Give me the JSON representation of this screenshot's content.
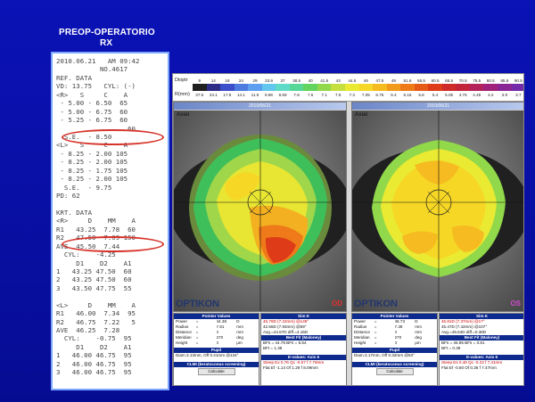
{
  "slide": {
    "title_line1": "PREOP-OPERATORIO",
    "title_line2": "RX"
  },
  "receipt": {
    "lines": [
      "2010.06.21   AM 09:42",
      "           NO.4617",
      "REF. DATA",
      "VD: 13.75   CYL: (-)",
      "<R>   S     C    A",
      " - 5.00 - 6.50  65",
      " - 5.00 - 6.75  60",
      " - 5.25 - 6.75  60",
      "                  60",
      "  S.E.  - 8.50",
      "<L>   S     C    A",
      " - 8.25 - 2.00 105",
      " - 8.25 - 2.00 105",
      " - 8.25 - 1.75 105",
      " - 8.25 - 2.00 105",
      "  S.E.  - 9.75",
      "PD: 62",
      "",
      "KRT. DATA",
      "<R>     D    MM    A",
      "R1   43.25  7.78  60",
      "R2   47.50  7.09 150",
      "AVE  45.50  7.44",
      "  CYL:    -4.25",
      "     D1    D2    A1",
      "1   43.25 47.50  60",
      "2   43.25 47.50  60",
      "3   43.50 47.75  55",
      "",
      "<L>     D    MM    A",
      "R1   46.00  7.34  95",
      "R2   46.75  7.22   5",
      "AVE  46.25  7.28",
      "  CYL:    -0.75  95",
      "     D1    D2    A1",
      "1   46.00 46.75  95",
      "2   46.00 46.75  95",
      "3   46.00 46.75  95"
    ]
  },
  "topo": {
    "scale": {
      "dioptr_label": "Dioptr",
      "r_label": "R(mm)",
      "dioptr": [
        "9",
        "14",
        "19",
        "24",
        "29",
        "33.9",
        "37",
        "38.5",
        "40",
        "41.5",
        "43",
        "44.5",
        "46",
        "47.5",
        "49",
        "51.6",
        "55.5",
        "60.5",
        "65.5",
        "70.5",
        "75.5",
        "80.5",
        "85.5",
        "90.5"
      ],
      "rmm": [
        "37.5",
        "24.1",
        "17.8",
        "14.1",
        "11.6",
        "9.96",
        "8.59",
        "7.8",
        "7.5",
        "7.1",
        "7.5",
        "7.3",
        "7.05",
        "6.75",
        "6.4",
        "6.15",
        "5.8",
        "5.4",
        "5.05",
        "4.75",
        "4.45",
        "4.2",
        "3.9",
        "3.7"
      ],
      "colors": [
        "#1f1f1f",
        "#2c2c86",
        "#3a4fc9",
        "#4d7be0",
        "#5c9ff0",
        "#62c7ee",
        "#5ddbc7",
        "#56d798",
        "#63d45e",
        "#91d84a",
        "#c5df3f",
        "#eaea32",
        "#f6d725",
        "#f5bb20",
        "#f19a1c",
        "#ee7a1a",
        "#e65a18",
        "#de3c18",
        "#cf2a2a",
        "#c2243a",
        "#b3225a",
        "#a0227a",
        "#8a2596",
        "#7329a8"
      ]
    },
    "left": {
      "window_title": "2010/06/21",
      "axial_label": "Axial",
      "brand": "OPTIKON",
      "eye_label": "OD",
      "pointer_header": "Pointer Values",
      "sim_header": "Sim K",
      "pointer_rows": [
        [
          "Power",
          "=",
          "44.38",
          "D"
        ],
        [
          "Radius",
          "=",
          "7.61",
          "mm"
        ],
        [
          "Distance",
          "=",
          "0",
          "mm"
        ],
        [
          "Meridian",
          "=",
          "270",
          "deg"
        ],
        [
          "Height",
          "=",
          "0",
          "μm"
        ]
      ],
      "sim_rows": [
        "46.76D (7.22mm) @149°",
        "42.56D (7.93mm) @59°",
        "Avg.=44.67D  diff.=4.16D"
      ],
      "bestfit_header": "Best Fit (Maloney)",
      "bestfit_rows": [
        "BFs = 44.79  BFs = 5.54",
        "BFt = 1.38"
      ],
      "pupil_header": "Pupil",
      "pupil_row": "Diam.3.13mm, Off 0.41mm @134°",
      "evalues_header": "E-values: Axis 6",
      "evalues_rows": [
        "Steep  Ex 0.76 Qc -0.57 f 7.79mm",
        "Flat   Ef -1.14 Of 1.29 f 8.09mm"
      ],
      "clmi_header": "CLMI (keratoconus screening)",
      "calc_button": "Calculate"
    },
    "right": {
      "window_title": "2010/06/21",
      "axial_label": "Axial",
      "brand": "OPTIKON",
      "eye_label": "OS",
      "pointer_header": "Pointer Values",
      "sim_header": "Sim K",
      "pointer_rows": [
        [
          "Power",
          "=",
          "46.73",
          "D"
        ],
        [
          "Radius",
          "=",
          "7.38",
          "mm"
        ],
        [
          "Distance",
          "=",
          "0",
          "mm"
        ],
        [
          "Meridian",
          "=",
          "270",
          "deg"
        ],
        [
          "Height",
          "=",
          "0",
          "μm"
        ]
      ],
      "sim_rows": [
        "45.81D (7.37mm) @17°",
        "45.47D (7.42mm) @107°",
        "Avg.=45.64D  diff.=0.38D"
      ],
      "bestfit_header": "Best Fit (Maloney)",
      "bestfit_rows": [
        "BFs = 45.95  BFs = 0.81",
        "BFt = 0.39"
      ],
      "pupil_header": "Pupil",
      "pupil_row": "Diam.3.17mm, Off 0.32mm @53°",
      "evalues_header": "E-values: Axis 6",
      "evalues_rows": [
        "Steep  Es 0.46 Qc -0.23 f 7.41mm",
        "Flat   Ef -0.60 Of 0.36 f 7.47mm"
      ],
      "clmi_header": "CLMI (keratoconus screening)",
      "calc_button": "Calculate"
    }
  }
}
